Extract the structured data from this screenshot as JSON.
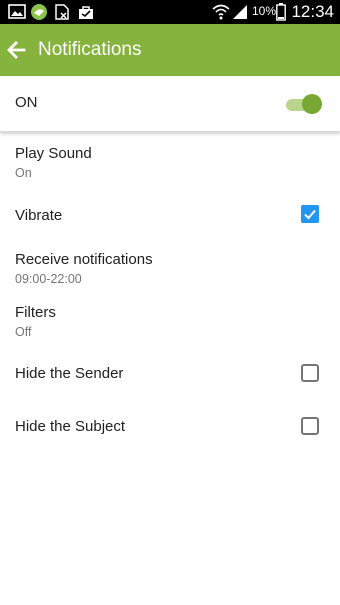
{
  "status_bar": {
    "icons": [
      "image-icon",
      "app-icon",
      "sim-icon",
      "shopping-bag-icon",
      "wifi-icon",
      "signal-icon",
      "battery-icon"
    ],
    "battery": "10%",
    "time": "12:34"
  },
  "app_bar": {
    "title": "Notifications",
    "back_icon": "arrow-left-icon",
    "color": "#86b33d"
  },
  "master": {
    "label": "ON",
    "enabled": true,
    "accent": "#78a832"
  },
  "settings": [
    {
      "title": "Play Sound",
      "summary": "On"
    },
    {
      "title": "Vibrate",
      "checked": true
    },
    {
      "title": "Receive notifications",
      "summary": "09:00-22:00"
    },
    {
      "title": "Filters",
      "summary": "Off"
    },
    {
      "title": "Hide the Sender",
      "checked": false
    },
    {
      "title": "Hide the Subject",
      "checked": false
    }
  ],
  "colors": {
    "checkbox_checked": "#2196f3",
    "checkbox_unchecked_border": "#757575"
  }
}
